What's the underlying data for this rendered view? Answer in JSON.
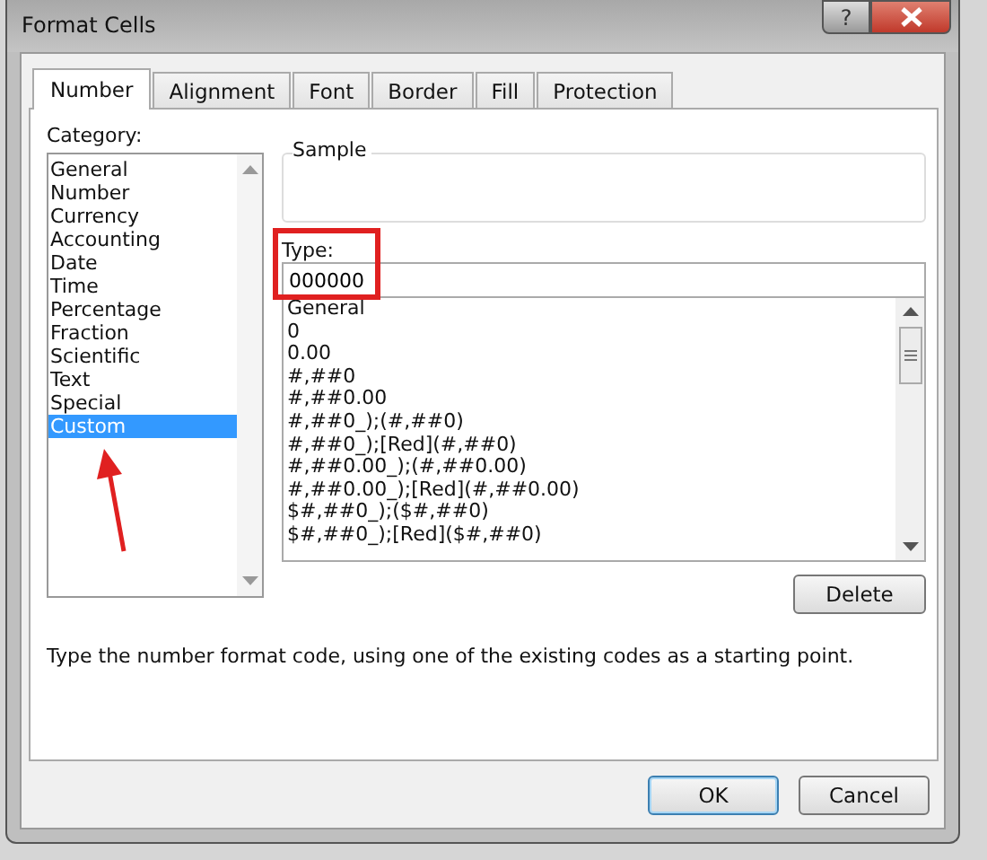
{
  "window": {
    "title": "Format Cells",
    "help_button": "?"
  },
  "tabs": [
    {
      "label": "Number",
      "selected": true
    },
    {
      "label": "Alignment",
      "selected": false
    },
    {
      "label": "Font",
      "selected": false
    },
    {
      "label": "Border",
      "selected": false
    },
    {
      "label": "Fill",
      "selected": false
    },
    {
      "label": "Protection",
      "selected": false
    }
  ],
  "category": {
    "label": "Category:",
    "items": [
      {
        "label": "General",
        "selected": false
      },
      {
        "label": "Number",
        "selected": false
      },
      {
        "label": "Currency",
        "selected": false
      },
      {
        "label": "Accounting",
        "selected": false
      },
      {
        "label": "Date",
        "selected": false
      },
      {
        "label": "Time",
        "selected": false
      },
      {
        "label": "Percentage",
        "selected": false
      },
      {
        "label": "Fraction",
        "selected": false
      },
      {
        "label": "Scientific",
        "selected": false
      },
      {
        "label": "Text",
        "selected": false
      },
      {
        "label": "Special",
        "selected": false
      },
      {
        "label": "Custom",
        "selected": true
      }
    ]
  },
  "sample": {
    "label": "Sample"
  },
  "type": {
    "label": "Type:",
    "value": "000000"
  },
  "formats": [
    "General",
    "0",
    "0.00",
    "#,##0",
    "#,##0.00",
    "#,##0_);(#,##0)",
    "#,##0_);[Red](#,##0)",
    "#,##0.00_);(#,##0.00)",
    "#,##0.00_);[Red](#,##0.00)",
    "$#,##0_);($#,##0)",
    "$#,##0_);[Red]($#,##0)"
  ],
  "delete_button": "Delete",
  "description": "Type the number format code, using one of the existing codes as a starting point.",
  "buttons": [
    {
      "label": "OK",
      "default": true
    },
    {
      "label": "Cancel",
      "default": false
    }
  ]
}
